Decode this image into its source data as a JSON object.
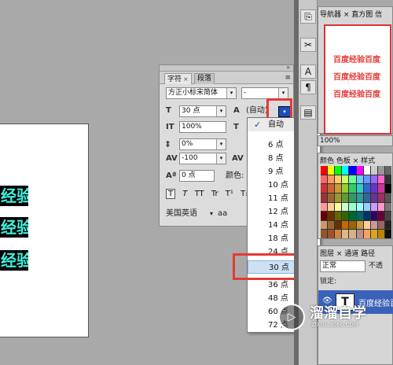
{
  "canvas": {
    "lines": [
      "经验",
      "经验",
      "经验"
    ]
  },
  "character_panel": {
    "tabs": [
      "字符",
      "段落"
    ],
    "font_family": "方正小标宋简体",
    "font_style": "-",
    "font_size": "30 点",
    "leading": "(自动)",
    "vertical_scale": "100%",
    "baseline_shift": "0%",
    "tracking": "-100",
    "kerning_value": "0 点",
    "color_label": "颜色:",
    "style_buttons": [
      "T",
      "T",
      "TT",
      "Tr",
      "T¹",
      "T₁"
    ],
    "language": "美国英语",
    "aa_label": "aa"
  },
  "leading_dropdown": {
    "items": [
      "自动",
      "6 点",
      "8 点",
      "9 点",
      "10 点",
      "11 点",
      "12 点",
      "14 点",
      "18 点",
      "24 点",
      "30 点",
      "36 点",
      "48 点",
      "60 点",
      "72 点"
    ],
    "checked": "自动",
    "highlighted": "30 点"
  },
  "right_panels": {
    "navigator_tabs": [
      "导航器 ×",
      "直方图",
      "信"
    ],
    "navigator_preview_text": [
      "百度经验百度",
      "百度经验百度",
      "百度经验百度"
    ],
    "zoom": "100%",
    "color_tabs": [
      "颜色",
      "色板 ×",
      "样式"
    ],
    "layers_tabs": [
      "图层 ×",
      "通道",
      "路径"
    ],
    "blend_mode": "正常",
    "opacity_label": "不透",
    "lock_label": "锁定:",
    "layer_name": "百度经验百"
  },
  "watermark": {
    "title": "溜溜自学",
    "subtitle": "ZIXUE.3066.COM"
  },
  "colors": {
    "highlight_red": "#e53935",
    "selection_blue": "#1c50b8",
    "canvas_text": "#3ff0e0"
  }
}
